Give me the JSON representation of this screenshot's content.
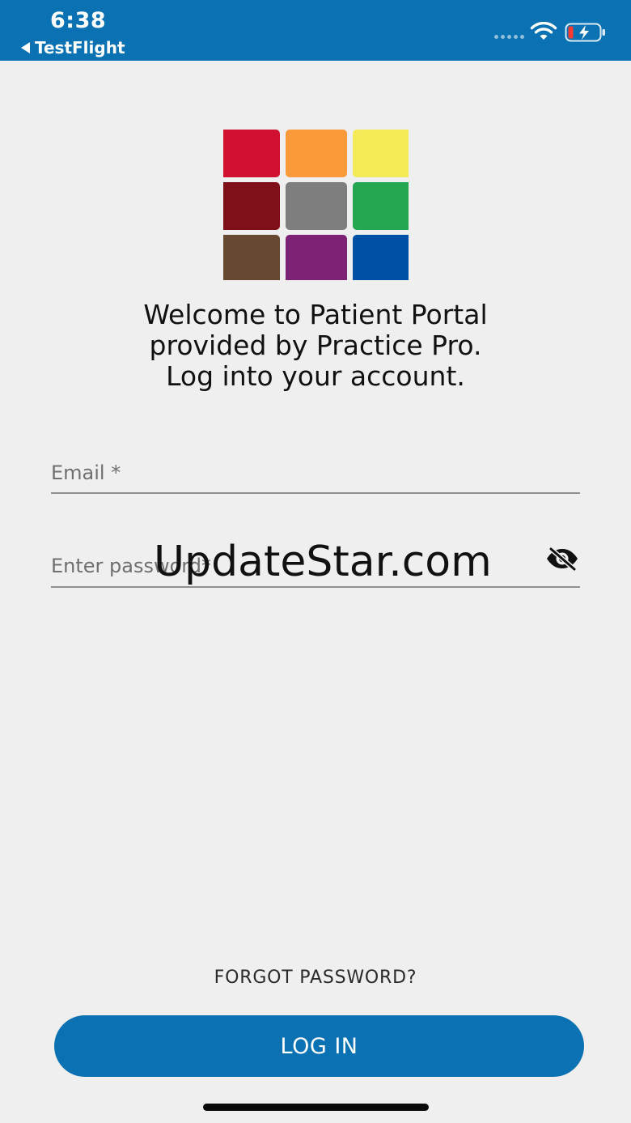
{
  "status_bar": {
    "time": "6:38",
    "back_app": "TestFlight",
    "wifi_icon": "wifi-icon",
    "battery_icon": "battery-charging-icon",
    "background_color": "#0a72b3"
  },
  "logo": {
    "icon": "color-grid-logo",
    "tile_colors": [
      "#d0112f",
      "#fb9a3b",
      "#f2ea57",
      "#7f0f18",
      "#7e7e7e",
      "#24a653",
      "#654930",
      "#7c2375",
      "#0050a5"
    ]
  },
  "welcome": {
    "line1": "Welcome to Patient Portal",
    "line2": "provided by Practice Pro.",
    "line3": "Log into your account."
  },
  "form": {
    "email_placeholder": "Email *",
    "email_value": "",
    "password_placeholder": "Enter password*",
    "password_value": "",
    "visibility_icon": "eye-off-icon"
  },
  "watermark": "UpdateStar.com",
  "forgot_password": "FORGOT PASSWORD?",
  "login_button": "LOG IN",
  "colors": {
    "primary": "#0a72b3",
    "background": "#efefef"
  }
}
